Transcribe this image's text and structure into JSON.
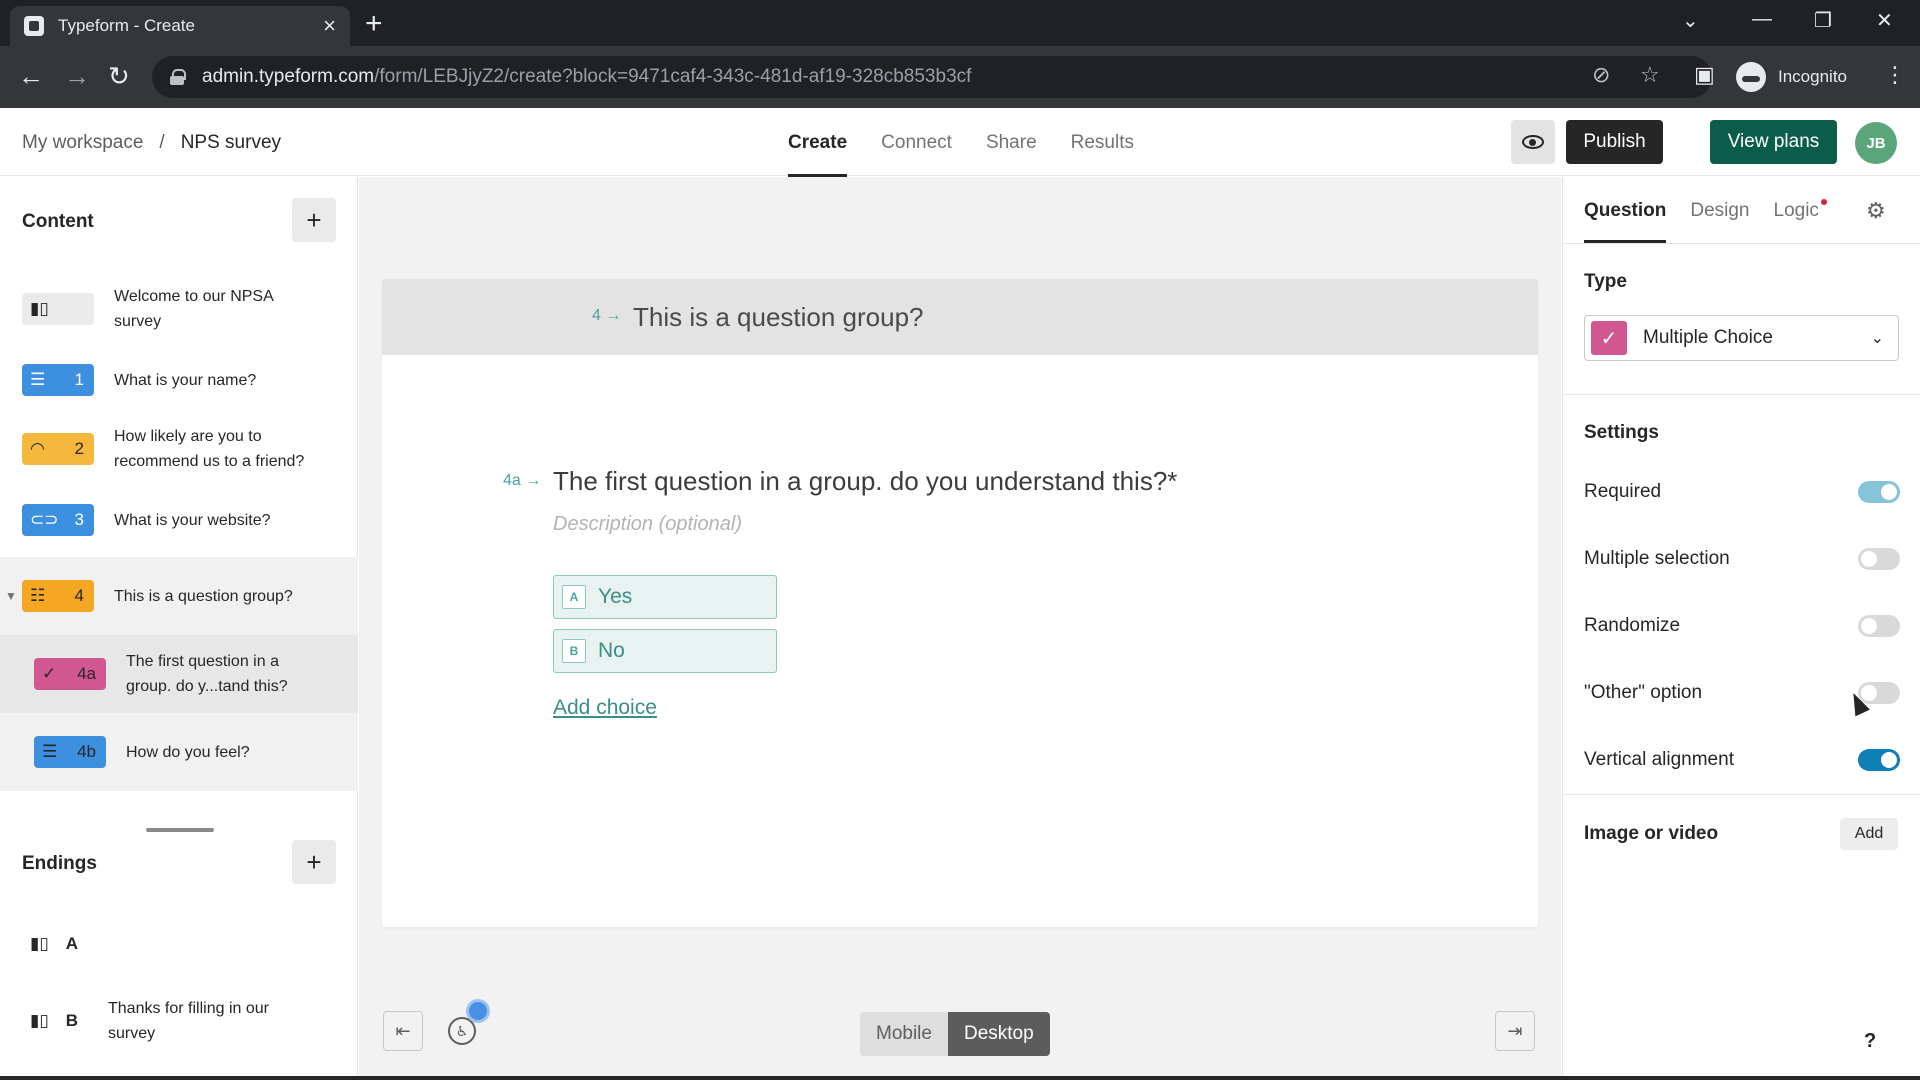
{
  "browser": {
    "tab_title": "Typeform - Create",
    "url_host": "admin.typeform.com",
    "url_path": "/form/LEBJjyZ2/create?block=9471caf4-343c-481d-af19-328cb853b3cf",
    "incognito_label": "Incognito"
  },
  "header": {
    "breadcrumb_workspace": "My workspace",
    "breadcrumb_sep": "/",
    "breadcrumb_form": "NPS survey",
    "nav": [
      "Create",
      "Connect",
      "Share",
      "Results"
    ],
    "publish": "Publish",
    "view_plans": "View plans",
    "avatar": "JB"
  },
  "sidebar": {
    "content_title": "Content",
    "endings_title": "Endings",
    "items": [
      {
        "num": "",
        "icon": "welcome-icon",
        "label": "Welcome to our NPSA survey",
        "color": "#e6e6e6"
      },
      {
        "num": "1",
        "icon": "short-text-icon",
        "label": "What is your name?",
        "color": "#3d8fe0"
      },
      {
        "num": "2",
        "icon": "opinion-scale-icon",
        "label": "How likely are you to recommend us to a friend?",
        "color": "#f5b83d"
      },
      {
        "num": "3",
        "icon": "link-icon",
        "label": "What is your website?",
        "color": "#3d8fe0"
      },
      {
        "num": "4",
        "icon": "question-group-icon",
        "label": "This is a question group?",
        "color": "#f5a623"
      },
      {
        "num": "4a",
        "icon": "checkmark-icon",
        "label": "The first question in a group. do y...tand this?",
        "color": "#d0578f"
      },
      {
        "num": "4b",
        "icon": "short-text-icon",
        "label": "How do you feel?",
        "color": "#3d8fe0"
      }
    ],
    "endings": [
      {
        "num": "A",
        "icon": "ending-icon",
        "label": ""
      },
      {
        "num": "B",
        "icon": "ending-icon",
        "label": "Thanks for filling in our survey"
      }
    ]
  },
  "canvas": {
    "group_num": "4",
    "group_title": "This is a question group?",
    "question_num": "4a",
    "question_title": "The first question in a group. do you understand this?*",
    "description_placeholder": "Description (optional)",
    "choices": [
      {
        "key": "A",
        "label": "Yes"
      },
      {
        "key": "B",
        "label": "No"
      }
    ],
    "add_choice": "Add choice",
    "device_mobile": "Mobile",
    "device_desktop": "Desktop"
  },
  "panel": {
    "tabs": [
      "Question",
      "Design",
      "Logic"
    ],
    "type_label": "Type",
    "type_value": "Multiple Choice",
    "settings_label": "Settings",
    "settings": [
      {
        "label": "Required",
        "on": true
      },
      {
        "label": "Multiple selection",
        "on": false
      },
      {
        "label": "Randomize",
        "on": false
      },
      {
        "label": "\"Other\" option",
        "on": false
      },
      {
        "label": "Vertical alignment",
        "on": true
      }
    ],
    "image_video_label": "Image or video",
    "add_label": "Add",
    "help": "?"
  },
  "colors": {
    "brand_green": "#0b5c4b",
    "accent_teal": "#4aa39a",
    "toggle_on": "#0f80b5"
  }
}
